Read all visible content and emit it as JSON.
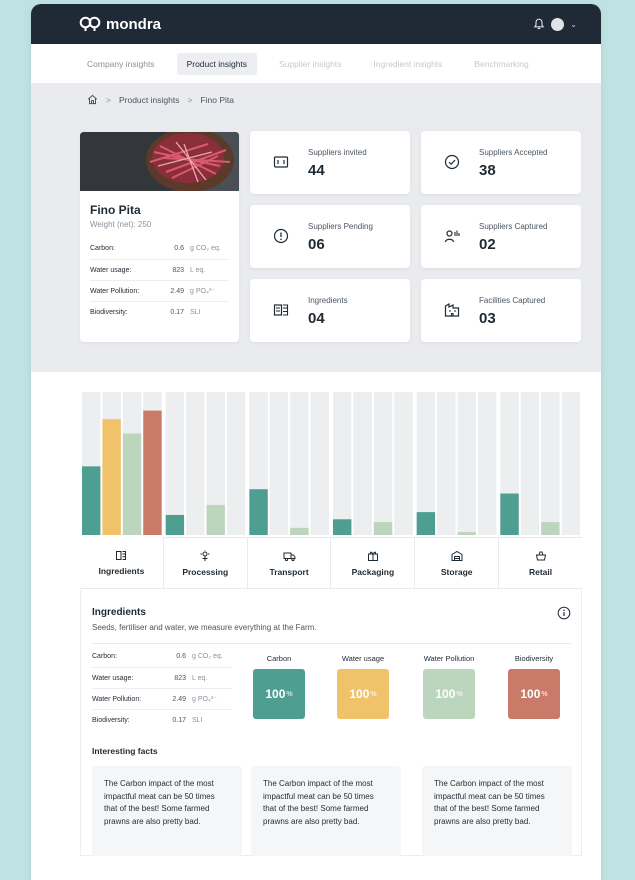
{
  "app": {
    "brand": "mondra"
  },
  "tabs": [
    {
      "label": "Company insights",
      "state": "normal"
    },
    {
      "label": "Product insights",
      "state": "active"
    },
    {
      "label": "Supplier insights",
      "state": "disabled"
    },
    {
      "label": "Ingredient insights",
      "state": "disabled"
    },
    {
      "label": "Benchmarking",
      "state": "disabled"
    }
  ],
  "breadcrumb": {
    "items": [
      "Product insights",
      "Fino Pita"
    ],
    "separator": ">"
  },
  "product": {
    "name": "Fino Pita",
    "weight": "Weight (net): 250",
    "metrics": [
      {
        "label": "Carbon:",
        "value": "0.6",
        "unit": "g CO₂ eq."
      },
      {
        "label": "Water usage:",
        "value": "823",
        "unit": "L eq."
      },
      {
        "label": "Water Pollution:",
        "value": "2.49",
        "unit": "g PO₄³⁻"
      },
      {
        "label": "Biodiversity:",
        "value": "0.17",
        "unit": "SLI"
      }
    ]
  },
  "stats": [
    {
      "label": "Suppliers invited",
      "value": "44",
      "icon": "invite-icon"
    },
    {
      "label": "Suppliers Accepted",
      "value": "38",
      "icon": "check-circle-icon"
    },
    {
      "label": "Suppliers Pending",
      "value": "06",
      "icon": "alert-circle-icon"
    },
    {
      "label": "Suppliers Captured",
      "value": "02",
      "icon": "users-icon"
    },
    {
      "label": "Ingredients",
      "value": "04",
      "icon": "ingredients-icon"
    },
    {
      "label": "Facilities Captured",
      "value": "03",
      "icon": "facility-icon"
    }
  ],
  "colors": {
    "carbon": "#4e9e92",
    "water_usage": "#f0c26a",
    "water_pollution": "#bcd6bd",
    "biodiversity": "#c97a68",
    "track": "#eceeef"
  },
  "chart_data": {
    "type": "bar",
    "categories": [
      "Ingredients",
      "Processing",
      "Transport",
      "Packaging",
      "Storage",
      "Retail"
    ],
    "series": [
      {
        "name": "Carbon",
        "values": [
          48,
          14,
          32,
          11,
          16,
          29
        ]
      },
      {
        "name": "Water usage",
        "values": [
          81,
          0,
          0,
          0,
          0,
          0
        ]
      },
      {
        "name": "Water Pollution",
        "values": [
          71,
          21,
          5,
          9,
          2,
          9
        ]
      },
      {
        "name": "Biodiversity",
        "values": [
          87,
          0,
          0,
          0,
          0,
          0
        ]
      }
    ],
    "ylim": [
      0,
      100
    ],
    "grid": false,
    "legend": "none"
  },
  "stages": [
    {
      "label": "Ingredients",
      "icon": "ingredients-icon",
      "active": true
    },
    {
      "label": "Processing",
      "icon": "processing-icon",
      "active": false
    },
    {
      "label": "Transport",
      "icon": "truck-icon",
      "active": false
    },
    {
      "label": "Packaging",
      "icon": "package-icon",
      "active": false
    },
    {
      "label": "Storage",
      "icon": "warehouse-icon",
      "active": false
    },
    {
      "label": "Retail",
      "icon": "basket-icon",
      "active": false
    }
  ],
  "detail": {
    "title": "Ingredients",
    "subtitle": "Seeds, fertiliser and water, we measure everything at the Farm.",
    "metrics": [
      {
        "label": "Carbon:",
        "value": "0.6",
        "unit": "g CO₂ eq."
      },
      {
        "label": "Water usage:",
        "value": "823",
        "unit": "L eq."
      },
      {
        "label": "Water Pollution:",
        "value": "2.49",
        "unit": "g PO₄³⁻"
      },
      {
        "label": "Biodiversity:",
        "value": "0.17",
        "unit": "SLI"
      }
    ],
    "tiles": [
      {
        "label": "Carbon",
        "value": "100",
        "unit": "%"
      },
      {
        "label": "Water usage",
        "value": "100",
        "unit": "%"
      },
      {
        "label": "Water Pollution",
        "value": "100",
        "unit": "%"
      },
      {
        "label": "Biodiversity",
        "value": "100",
        "unit": "%"
      }
    ],
    "facts_title": "Interesting facts",
    "facts": [
      "The Carbon impact of the most impactful meat can be 50 times that of the best! Some farmed prawns are also pretty bad.",
      "The Carbon impact of the most impactful meat can be 50 times that of the best! Some farmed prawns are also pretty bad.",
      "The Carbon impact of the most impactful meat can be 50 times that of the best! Some farmed prawns are also pretty bad."
    ]
  }
}
